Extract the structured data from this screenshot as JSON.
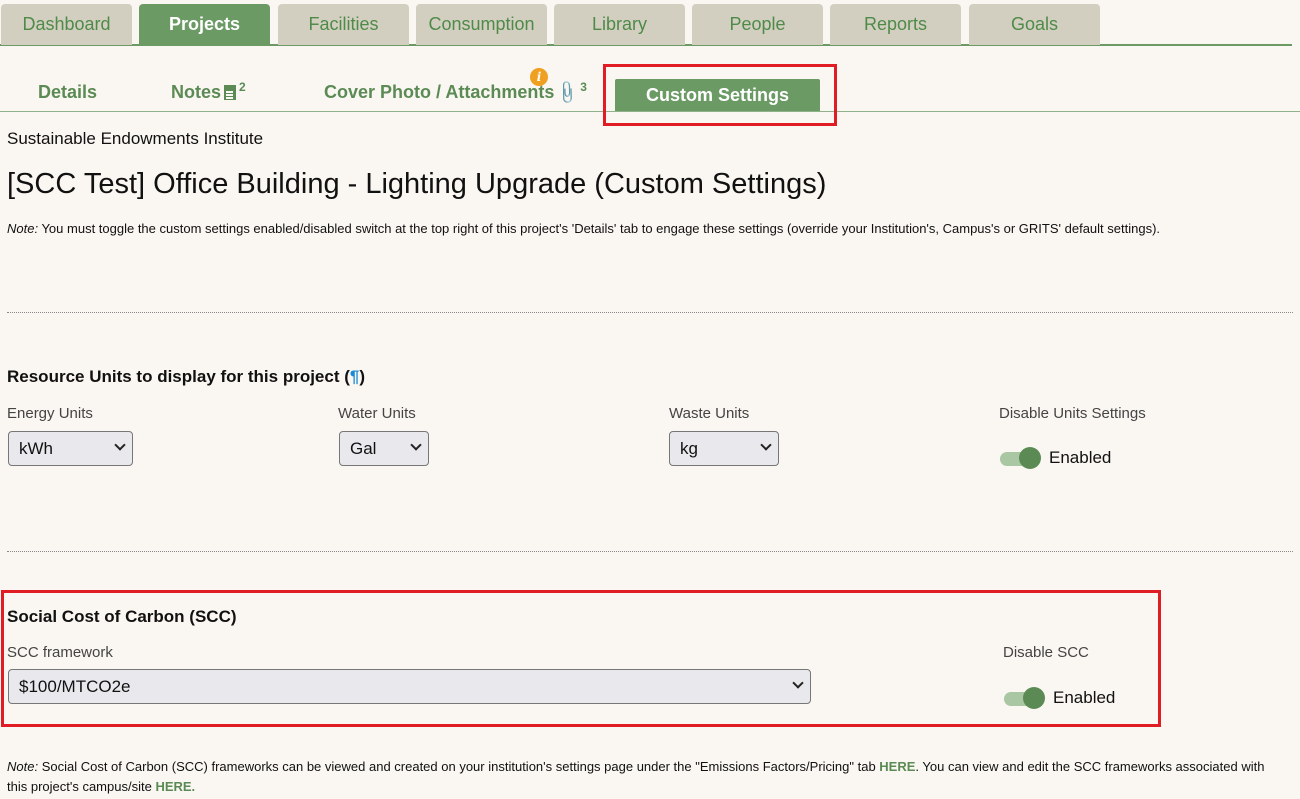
{
  "top_nav": [
    "Dashboard",
    "Projects",
    "Facilities",
    "Consumption",
    "Library",
    "People",
    "Reports",
    "Goals"
  ],
  "sub_nav": {
    "details": "Details",
    "notes": "Notes",
    "notes_count": "2",
    "attachments": "Cover Photo / Attachments",
    "attachments_count": "3",
    "info_badge": "i",
    "custom": "Custom Settings"
  },
  "org_name": "Sustainable Endowments Institute",
  "project_title": "[SCC Test] Office Building - Lighting Upgrade (Custom Settings)",
  "note1": {
    "label": "Note:",
    "text": " You must toggle the custom settings enabled/disabled switch at the top right of this project's 'Details' tab to engage these settings (override your Institution's, Campus's or GRITS' default settings)."
  },
  "units": {
    "heading": "Resource Units to display for this project (",
    "heading_icon": "¶",
    "heading_end": ")",
    "energy_label": "Energy Units",
    "energy_value": "kWh",
    "water_label": "Water Units",
    "water_value": "Gal",
    "waste_label": "Waste Units",
    "waste_value": "kg",
    "disable_label": "Disable Units Settings",
    "toggle_text": "Enabled"
  },
  "scc": {
    "heading": "Social Cost of Carbon (SCC)",
    "framework_label": "SCC framework",
    "framework_value": "$100/MTCO2e",
    "disable_label": "Disable SCC",
    "toggle_text": "Enabled"
  },
  "note2": {
    "label": "Note:",
    "text_a": " Social Cost of Carbon (SCC) frameworks can be viewed and created on your institution's settings page under the \"Emissions Factors/Pricing\" tab ",
    "link_a": "HERE",
    "text_b": ". You can view and edit the SCC frameworks associated with this project's campus/site ",
    "link_b": "HERE."
  },
  "colors": {
    "accent": "#6b9a64",
    "tab_inactive": "#d2cfc1",
    "highlight_box": "#e01c24",
    "info_badge": "#f0a020",
    "link": "#1a8ad6"
  }
}
